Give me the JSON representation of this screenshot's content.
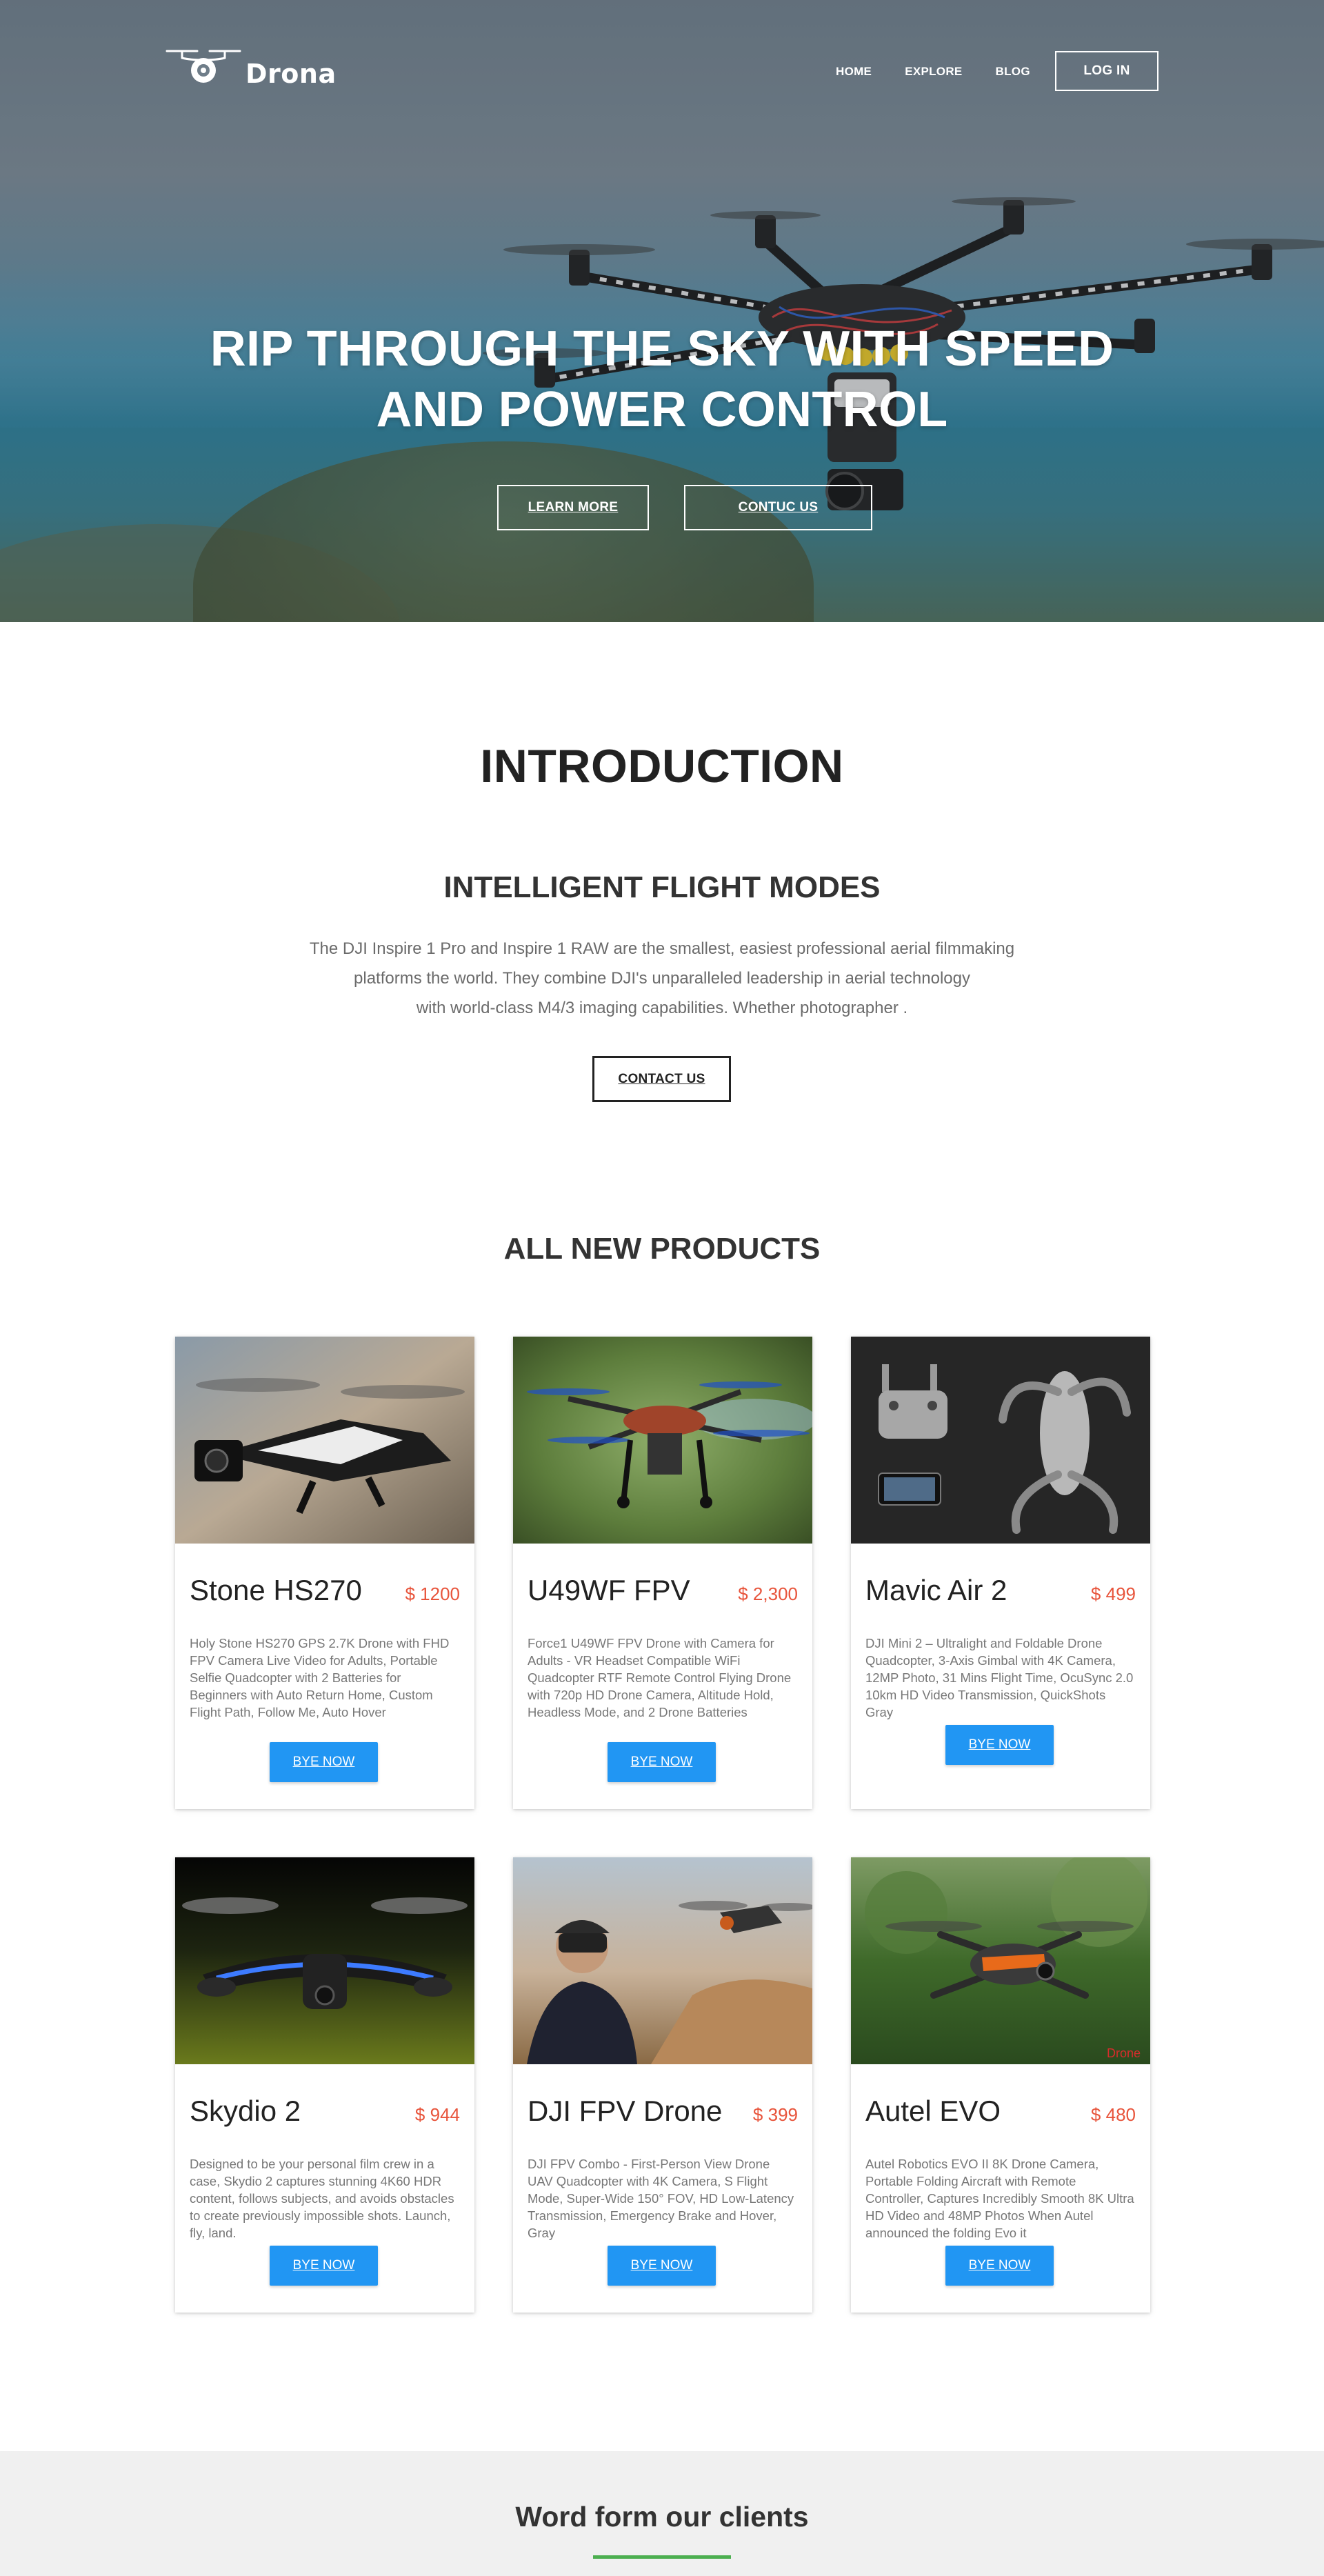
{
  "brand": {
    "name": "Drona"
  },
  "nav": {
    "items": [
      "HOME",
      "EXPLORE",
      "BLOG"
    ],
    "login_label": "LOG IN"
  },
  "hero": {
    "title_line1": "RIP THROUGH THE SKY WITH SPEED",
    "title_line2": "AND POWER CONTROL",
    "learn_label": "LEARN MORE",
    "contact_label": "CONTUC US"
  },
  "intro": {
    "title": "INTRODUCTION",
    "subtitle": "INTELLIGENT FLIGHT MODES",
    "paragraph_line1": "The DJI Inspire 1 Pro and Inspire 1 RAW are the smallest, easiest professional aerial filmmaking",
    "paragraph_line2": "platforms the world. They combine DJI's unparalleled leadership in aerial technology",
    "paragraph_line3": "with world-class M4/3 imaging capabilities. Whether photographer .",
    "button_label": "CONTACT US"
  },
  "products": {
    "title": "ALL NEW PRODUCTS",
    "buy_label": "BYE NOW",
    "items": [
      {
        "name": "Stone HS270",
        "price": "$ 1200",
        "description": "Holy Stone HS270 GPS 2.7K Drone with FHD FPV Camera Live Video for Adults, Portable Selfie Quadcopter with 2 Batteries for Beginners with Auto Return Home, Custom Flight Path, Follow Me, Auto Hover",
        "buy": "BYE NOW"
      },
      {
        "name": "U49WF FPV",
        "price": "$ 2,300",
        "description": "Force1 U49WF FPV Drone with Camera for Adults - VR Headset Compatible WiFi Quadcopter RTF Remote Control Flying Drone with 720p HD Drone Camera, Altitude Hold, Headless Mode, and 2 Drone Batteries",
        "buy": "BYE NOW"
      },
      {
        "name": "Mavic Air 2",
        "price": "$ 499",
        "description": "DJI Mini 2 – Ultralight and Foldable Drone Quadcopter, 3-Axis Gimbal with 4K Camera, 12MP Photo, 31 Mins Flight Time, OcuSync 2.0 10km HD Video Transmission, QuickShots Gray",
        "buy": "BYE NOW"
      },
      {
        "name": "Skydio 2",
        "price": "$ 944",
        "description": "Designed to be your personal film crew in a case, Skydio 2 captures stunning 4K60 HDR content, follows subjects, and avoids obstacles to create previously impossible shots. Launch, fly, land.",
        "buy": "BYE NOW"
      },
      {
        "name": "DJI FPV Drone",
        "price": "$ 399",
        "description": "DJI FPV Combo - First-Person View Drone UAV Quadcopter with 4K Camera, S Flight Mode, Super-Wide 150° FOV, HD Low-Latency Transmission, Emergency Brake and Hover, Gray",
        "buy": "BYE NOW"
      },
      {
        "name": "Autel EVO",
        "price": "$ 480",
        "description": "Autel Robotics EVO II 8K Drone Camera, Portable Folding Aircraft with Remote Controller, Captures Incredibly Smooth 8K Ultra HD Video and 48MP Photos When Autel announced the folding Evo it",
        "buy": "BYE NOW",
        "image_watermark": "Drone"
      }
    ]
  },
  "clients": {
    "title": "Word form our clients"
  },
  "colors": {
    "accent_blue": "#2196f3",
    "price_red": "#e8543b",
    "green_line": "#4caf50"
  }
}
